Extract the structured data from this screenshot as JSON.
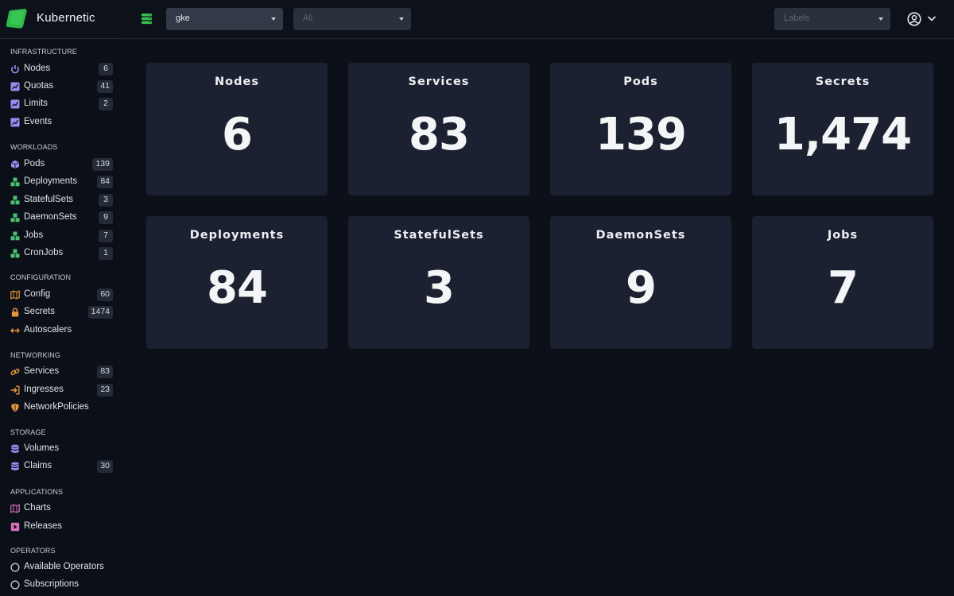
{
  "app": {
    "title": "Kubernetic"
  },
  "header": {
    "cluster_select": {
      "value": "gke"
    },
    "namespace_select": {
      "value": "All"
    },
    "labels_select": {
      "placeholder": "Labels"
    }
  },
  "sidebar": {
    "sections": [
      {
        "title": "INFRASTRUCTURE",
        "items": [
          {
            "label": "Nodes",
            "count": "6",
            "icon": "power-icon"
          },
          {
            "label": "Quotas",
            "count": "41",
            "icon": "chart-icon"
          },
          {
            "label": "Limits",
            "count": "2",
            "icon": "chart-icon"
          },
          {
            "label": "Events",
            "count": "",
            "icon": "chart-icon"
          }
        ]
      },
      {
        "title": "WORKLOADS",
        "items": [
          {
            "label": "Pods",
            "count": "139",
            "icon": "cube-icon"
          },
          {
            "label": "Deployments",
            "count": "84",
            "icon": "cubes-icon"
          },
          {
            "label": "StatefulSets",
            "count": "3",
            "icon": "cubes-icon"
          },
          {
            "label": "DaemonSets",
            "count": "9",
            "icon": "cubes-icon"
          },
          {
            "label": "Jobs",
            "count": "7",
            "icon": "cubes-icon"
          },
          {
            "label": "CronJobs",
            "count": "1",
            "icon": "cubes-icon"
          }
        ]
      },
      {
        "title": "CONFIGURATION",
        "items": [
          {
            "label": "Config",
            "count": "60",
            "icon": "map-icon"
          },
          {
            "label": "Secrets",
            "count": "1474",
            "icon": "lock-icon"
          },
          {
            "label": "Autoscalers",
            "count": "",
            "icon": "arrows-horizontal-icon"
          }
        ]
      },
      {
        "title": "NETWORKING",
        "items": [
          {
            "label": "Services",
            "count": "83",
            "icon": "link-icon"
          },
          {
            "label": "Ingresses",
            "count": "23",
            "icon": "sign-in-icon"
          },
          {
            "label": "NetworkPolicies",
            "count": "",
            "icon": "shield-icon"
          }
        ]
      },
      {
        "title": "STORAGE",
        "items": [
          {
            "label": "Volumes",
            "count": "",
            "icon": "database-icon"
          },
          {
            "label": "Claims",
            "count": "30",
            "icon": "database-icon"
          }
        ]
      },
      {
        "title": "APPLICATIONS",
        "items": [
          {
            "label": "Charts",
            "count": "",
            "icon": "map-icon"
          },
          {
            "label": "Releases",
            "count": "",
            "icon": "play-icon"
          }
        ]
      },
      {
        "title": "OPERATORS",
        "items": [
          {
            "label": "Available Operators",
            "count": "",
            "icon": "circle-icon"
          },
          {
            "label": "Subscriptions",
            "count": "",
            "icon": "circle-icon"
          }
        ]
      }
    ]
  },
  "dashboard": {
    "cards": [
      {
        "title": "Nodes",
        "value": "6"
      },
      {
        "title": "Services",
        "value": "83"
      },
      {
        "title": "Pods",
        "value": "139"
      },
      {
        "title": "Secrets",
        "value": "1,474"
      },
      {
        "title": "Deployments",
        "value": "84"
      },
      {
        "title": "StatefulSets",
        "value": "3"
      },
      {
        "title": "DaemonSets",
        "value": "9"
      },
      {
        "title": "Jobs",
        "value": "7"
      }
    ]
  },
  "colors": {
    "brand_green": "#37c24f",
    "infra_purple": "#9b8cf2",
    "workload_green": "#4bbf73",
    "config_orange": "#e8953a",
    "networking_orange": "#e8953a",
    "storage_purple": "#9b8cf2",
    "applications_pink": "#d86fbd"
  }
}
